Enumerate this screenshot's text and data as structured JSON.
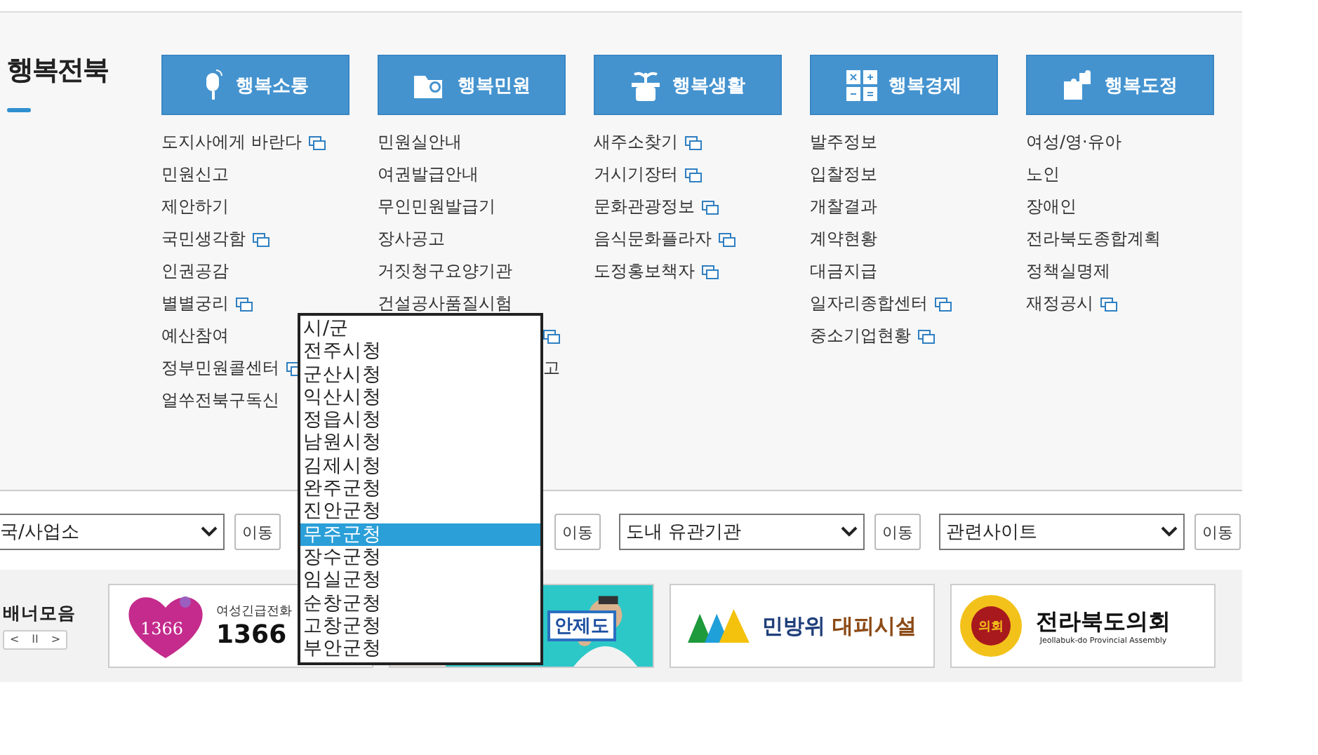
{
  "section_title": "행복전북",
  "menus": [
    {
      "title": "행복소통",
      "items": [
        {
          "text": "도지사에게 바란다",
          "new_window": true
        },
        {
          "text": "민원신고",
          "new_window": false
        },
        {
          "text": "제안하기",
          "new_window": false
        },
        {
          "text": "국민생각함",
          "new_window": true
        },
        {
          "text": "인권공감",
          "new_window": false
        },
        {
          "text": "별별궁리",
          "new_window": true
        },
        {
          "text": "예산참여",
          "new_window": false
        },
        {
          "text": "정부민원콜센터",
          "new_window": true
        },
        {
          "text": "얼쑤전북구독신",
          "new_window": false
        }
      ]
    },
    {
      "title": "행복민원",
      "items": [
        {
          "text": "민원실안내",
          "new_window": false
        },
        {
          "text": "여권발급안내",
          "new_window": false
        },
        {
          "text": "무인민원발급기",
          "new_window": false
        },
        {
          "text": "장사공고",
          "new_window": false
        },
        {
          "text": "거짓청구요양기관",
          "new_window": false
        },
        {
          "text": "건설공사품질시험",
          "new_window": false
        },
        {
          "kind": "tail",
          "new_window": true
        },
        {
          "kind": "tail",
          "text": "고",
          "new_window": false
        }
      ]
    },
    {
      "title": "행복생활",
      "items": [
        {
          "text": "새주소찾기",
          "new_window": true
        },
        {
          "text": "거시기장터",
          "new_window": true
        },
        {
          "text": "문화관광정보",
          "new_window": true
        },
        {
          "text": "음식문화플라자",
          "new_window": true
        },
        {
          "text": "도정홍보책자",
          "new_window": true
        }
      ]
    },
    {
      "title": "행복경제",
      "items": [
        {
          "text": "발주정보",
          "new_window": false
        },
        {
          "text": "입찰정보",
          "new_window": false
        },
        {
          "text": "개찰결과",
          "new_window": false
        },
        {
          "text": "계약현황",
          "new_window": false
        },
        {
          "text": "대금지급",
          "new_window": false
        },
        {
          "text": "일자리종합센터",
          "new_window": true
        },
        {
          "text": "중소기업현황",
          "new_window": true
        }
      ]
    },
    {
      "title": "행복도정",
      "items": [
        {
          "text": "여성/영·유아",
          "new_window": false
        },
        {
          "text": "노인",
          "new_window": false
        },
        {
          "text": "장애인",
          "new_window": false
        },
        {
          "text": "전라북도종합계획",
          "new_window": false
        },
        {
          "text": "정책실명제",
          "new_window": false
        },
        {
          "text": "재정공시",
          "new_window": true
        }
      ]
    }
  ],
  "selects": [
    {
      "value": "국/사업소",
      "button": "이동"
    },
    {
      "button": "이동"
    },
    {
      "value": "도내 유관기관",
      "button": "이동"
    },
    {
      "value": "관련사이트",
      "button": "이동"
    }
  ],
  "dropdown": {
    "options": [
      {
        "text": "시/군",
        "selected": false
      },
      {
        "text": "전주시청",
        "selected": false
      },
      {
        "text": "군산시청",
        "selected": false
      },
      {
        "text": "익산시청",
        "selected": false
      },
      {
        "text": "정읍시청",
        "selected": false
      },
      {
        "text": "남원시청",
        "selected": false
      },
      {
        "text": "김제시청",
        "selected": false
      },
      {
        "text": "완주군청",
        "selected": false
      },
      {
        "text": "진안군청",
        "selected": false
      },
      {
        "text": "무주군청",
        "selected": true
      },
      {
        "text": "장수군청",
        "selected": false
      },
      {
        "text": "임실군청",
        "selected": false
      },
      {
        "text": "순창군청",
        "selected": false
      },
      {
        "text": "고창군청",
        "selected": false
      },
      {
        "text": "부안군청",
        "selected": false
      }
    ]
  },
  "banners": {
    "label": "배너모음",
    "controls": [
      "<",
      "II",
      ">"
    ],
    "items": [
      {
        "kind": "hotline",
        "logo_text": "1366",
        "caption": "여성긴급전화",
        "number": "1366"
      },
      {
        "text": "안제도"
      },
      {
        "kind": "shelter",
        "text_a": "민방위",
        "text_b": "대피시설"
      },
      {
        "kind": "assembly",
        "seal": "의회",
        "name": "전라북도의회",
        "subtitle": "Jeollabuk-do Provincial Assembly"
      }
    ]
  }
}
